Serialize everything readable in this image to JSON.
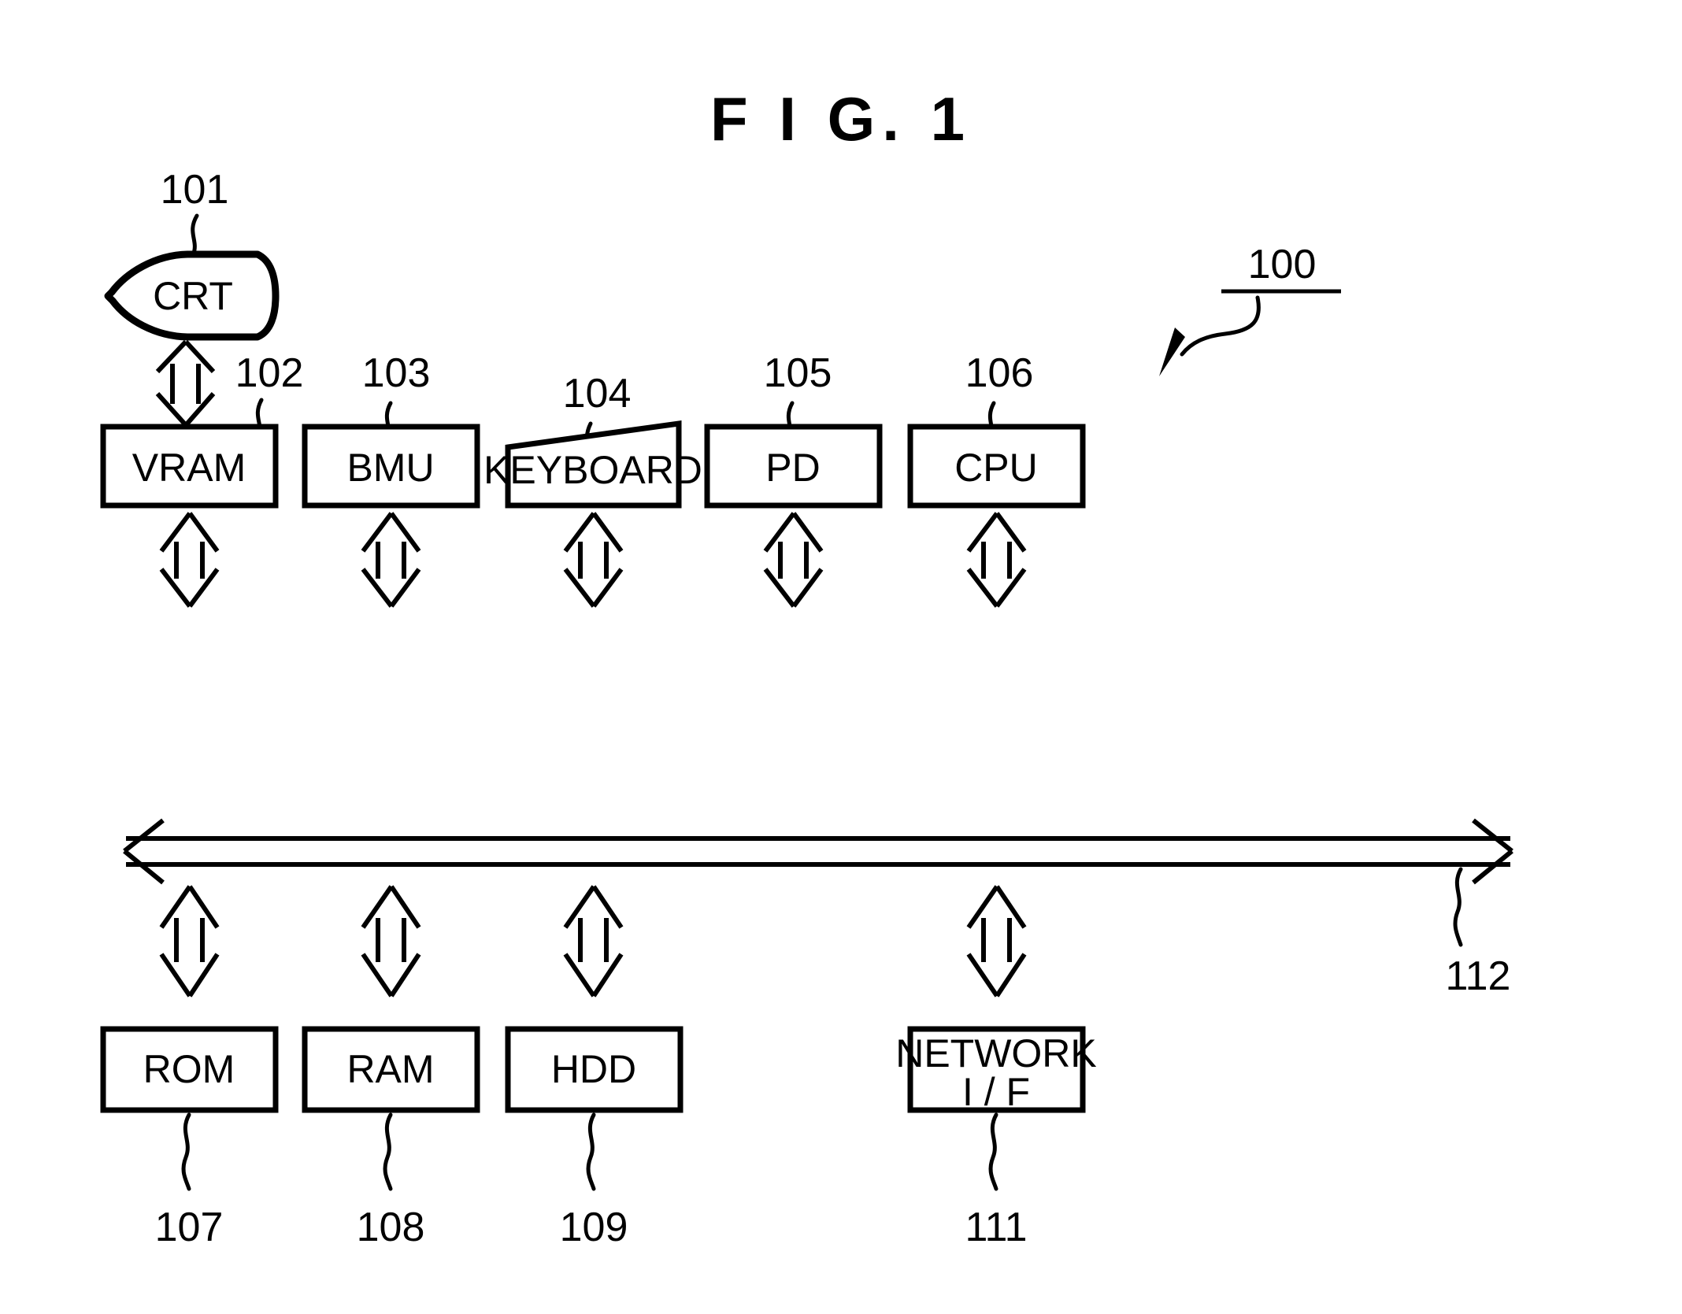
{
  "figure": {
    "title": "F I G.  1",
    "system_reference": "100"
  },
  "components": {
    "crt": {
      "label": "CRT",
      "ref": "101"
    },
    "vram": {
      "label": "VRAM",
      "ref": "102"
    },
    "bmu": {
      "label": "BMU",
      "ref": "103"
    },
    "keyboard": {
      "label": "KEYBOARD",
      "ref": "104"
    },
    "pd": {
      "label": "PD",
      "ref": "105"
    },
    "cpu": {
      "label": "CPU",
      "ref": "106"
    },
    "rom": {
      "label": "ROM",
      "ref": "107"
    },
    "ram": {
      "label": "RAM",
      "ref": "108"
    },
    "hdd": {
      "label": "HDD",
      "ref": "109"
    },
    "network_if": {
      "label_line1": "NETWORK",
      "label_line2": "I / F",
      "ref": "111"
    },
    "bus": {
      "label": "",
      "ref": "112"
    }
  },
  "colors": {
    "ink": "#000000",
    "paper": "#ffffff"
  }
}
